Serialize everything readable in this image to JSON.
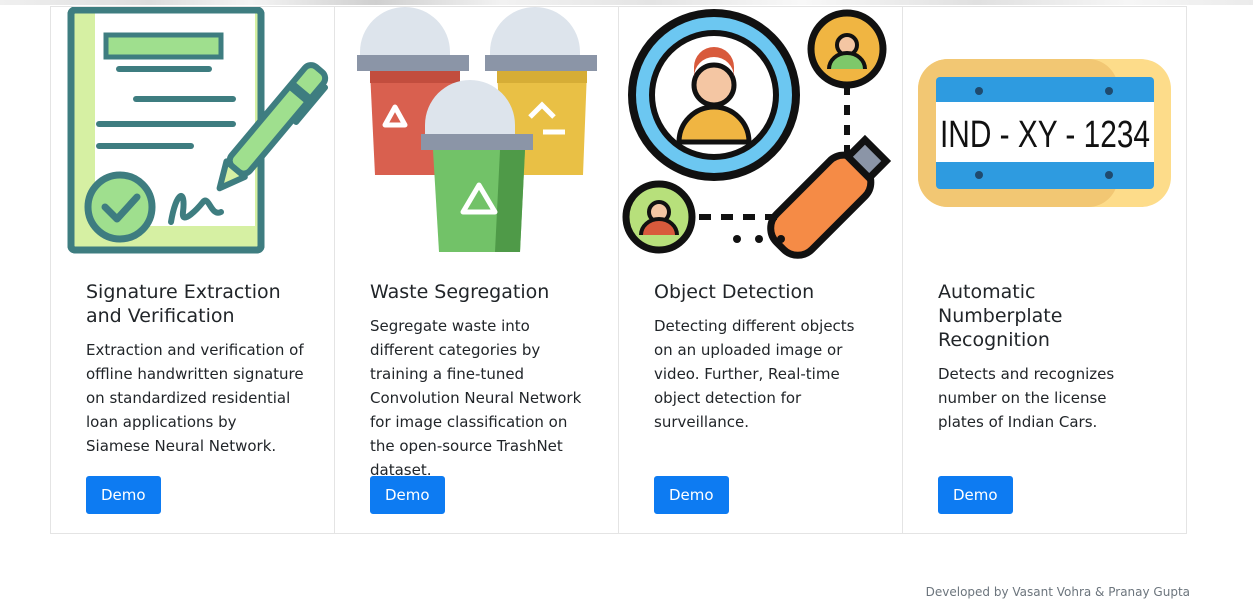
{
  "cards": [
    {
      "title": "Signature Extraction and Verification",
      "text": "Extraction and verification of offline handwritten signature on standardized residential loan applications by Siamese Neural Network.",
      "button": "Demo",
      "icon": "signature-document-icon"
    },
    {
      "title": "Waste Segregation",
      "text": "Segregate waste into different categories by training a fine-tuned Convolution Neural Network for image classification on the open-source TrashNet dataset.",
      "button": "Demo",
      "icon": "recycling-bins-icon"
    },
    {
      "title": "Object Detection",
      "text": "Detecting different objects on an uploaded image or video. Further, Real-time object detection for surveillance.",
      "button": "Demo",
      "icon": "magnifier-person-icon"
    },
    {
      "title": "Automatic Numberplate Recognition",
      "text": "Detects and recognizes number on the license plates of Indian Cars.",
      "button": "Demo",
      "icon": "license-plate-icon",
      "plate_text": "IND - XY - 1234"
    }
  ],
  "footer": "Developed by Vasant Vohra & Pranay Gupta",
  "colors": {
    "button": "#0d7bf2",
    "border": "#e4e4e4",
    "footer": "#6c757d"
  }
}
